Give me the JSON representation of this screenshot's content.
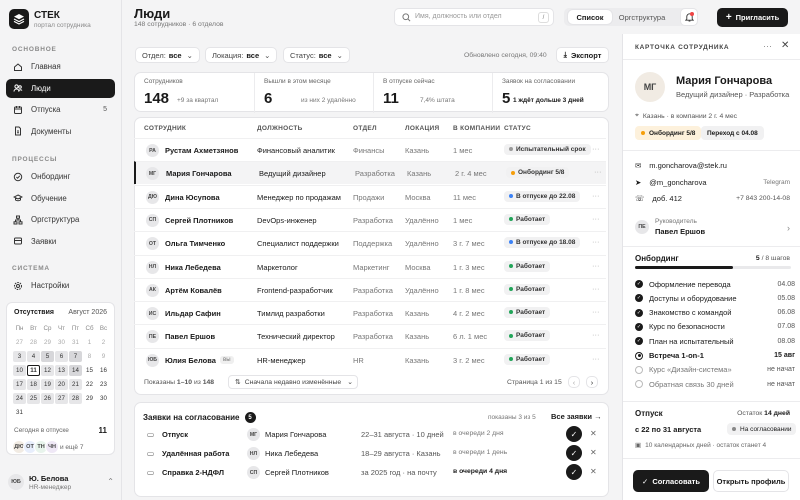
{
  "brand": {
    "name": "СТЕК",
    "sub": "портал сотрудника"
  },
  "sidebar": {
    "main_label": "ОСНОВНОЕ",
    "main_items": [
      {
        "label": "Главная",
        "icon": "home-icon"
      },
      {
        "label": "Люди",
        "icon": "people-icon",
        "active": true
      },
      {
        "label": "Отпуска",
        "icon": "calendar-icon",
        "count": "5"
      },
      {
        "label": "Документы",
        "icon": "document-icon"
      }
    ],
    "proc_label": "ПРОЦЕССЫ",
    "proc_items": [
      {
        "label": "Онбординг",
        "icon": "onboarding-icon"
      },
      {
        "label": "Обучение",
        "icon": "education-icon"
      },
      {
        "label": "Оргструктура",
        "icon": "org-icon"
      },
      {
        "label": "Заявки",
        "icon": "requests-icon"
      }
    ],
    "sys_label": "СИСТЕМА",
    "sys_items": [
      {
        "label": "Настройки",
        "icon": "gear-icon"
      }
    ]
  },
  "calendar": {
    "title": "Отсутствия",
    "month": "Август 2026",
    "weekdays": [
      "Пн",
      "Вт",
      "Ср",
      "Чт",
      "Пт",
      "Сб",
      "Вс"
    ],
    "days": [
      {
        "d": "27",
        "m": 1
      },
      {
        "d": "28",
        "m": 1
      },
      {
        "d": "29",
        "m": 1
      },
      {
        "d": "30",
        "m": 1
      },
      {
        "d": "31",
        "m": 1
      },
      {
        "d": "1",
        "m": 1
      },
      {
        "d": "2",
        "m": 1
      },
      {
        "d": "3",
        "e": 1
      },
      {
        "d": "4",
        "e": 1
      },
      {
        "d": "5",
        "e": 2
      },
      {
        "d": "6",
        "e": 1
      },
      {
        "d": "7",
        "e": 2
      },
      {
        "d": "8",
        "m": 1
      },
      {
        "d": "9",
        "m": 1
      },
      {
        "d": "10",
        "e": 1
      },
      {
        "d": "11",
        "t": 1
      },
      {
        "d": "12",
        "e": 1
      },
      {
        "d": "13",
        "e": 1
      },
      {
        "d": "14",
        "e": 2
      },
      {
        "d": "15"
      },
      {
        "d": "16"
      },
      {
        "d": "17",
        "e": 1
      },
      {
        "d": "18",
        "e": 1
      },
      {
        "d": "19",
        "e": 1
      },
      {
        "d": "20",
        "e": 1
      },
      {
        "d": "21",
        "e": 1
      },
      {
        "d": "22"
      },
      {
        "d": "23"
      },
      {
        "d": "24",
        "e": 1
      },
      {
        "d": "25",
        "e": 1
      },
      {
        "d": "26",
        "e": 1
      },
      {
        "d": "27",
        "e": 1
      },
      {
        "d": "28",
        "e": 1
      },
      {
        "d": "29"
      },
      {
        "d": "30"
      },
      {
        "d": "31"
      }
    ],
    "today_label": "Сегодня в отпуске",
    "today_count": "11",
    "avatars": [
      "ДЮ",
      "ОТ",
      "ТН",
      "ЧН"
    ],
    "more": "и ещё 7"
  },
  "current_user": {
    "initials": "ЮБ",
    "name": "Ю. Белова",
    "role": "HR-менеджер"
  },
  "header": {
    "title": "Люди",
    "subtitle": "148 сотрудников · 6 отделов",
    "search_placeholder": "Имя, должность или отдел",
    "search_key": "/",
    "view_list": "Список",
    "view_org": "Оргструктура",
    "invite": "Пригласить"
  },
  "filters": {
    "dept_label": "Отдел:",
    "dept_value": "все",
    "loc_label": "Локация:",
    "loc_value": "все",
    "status_label": "Статус:",
    "status_value": "все",
    "updated": "Обновлено сегодня, 09:40",
    "export": "Экспорт"
  },
  "kpis": [
    {
      "label": "Сотрудников",
      "value": "148",
      "sub": "+9 за квартал"
    },
    {
      "label": "Вышли в этом месяце",
      "value": "6",
      "sub": "из них 2 удалённо"
    },
    {
      "label": "В отпуске сейчас",
      "value": "11",
      "sub": "7,4% штата"
    },
    {
      "label": "Заявок на согласовании",
      "value": "5",
      "sub": "1 ждёт дольше 3 дней"
    }
  ],
  "table": {
    "columns": [
      "СОТРУДНИК",
      "ДОЛЖНОСТЬ",
      "ОТДЕЛ",
      "ЛОКАЦИЯ",
      "В КОМПАНИИ",
      "СТАТУС"
    ],
    "rows": [
      {
        "initials": "РА",
        "name": "Рустам Ахметзянов",
        "role": "Финансовый аналитик",
        "dept": "Финансы",
        "loc": "Казань",
        "tenure": "1 мес",
        "status": "Испытательный срок",
        "color": "#9a9a9a"
      },
      {
        "initials": "МГ",
        "name": "Мария Гончарова",
        "role": "Ведущий дизайнер",
        "dept": "Разработка",
        "loc": "Казань",
        "tenure": "2 г. 4 мес",
        "status": "Онбординг 5/8",
        "color": "#f59e0b",
        "sel": true
      },
      {
        "initials": "ДЮ",
        "name": "Дина Юсупова",
        "role": "Менеджер по продажам",
        "dept": "Продажи",
        "loc": "Москва",
        "tenure": "11 мес",
        "status": "В отпуске до 22.08",
        "color": "#3b82f6"
      },
      {
        "initials": "СП",
        "name": "Сергей Плотников",
        "role": "DevOps-инженер",
        "dept": "Разработка",
        "loc": "Удалённо",
        "tenure": "1 мес",
        "status": "Работает",
        "color": "#22a559"
      },
      {
        "initials": "ОТ",
        "name": "Ольга Тимченко",
        "role": "Специалист поддержки",
        "dept": "Поддержка",
        "loc": "Удалённо",
        "tenure": "3 г. 7 мес",
        "status": "В отпуске до 18.08",
        "color": "#3b82f6"
      },
      {
        "initials": "НЛ",
        "name": "Ника Лебедева",
        "role": "Маркетолог",
        "dept": "Маркетинг",
        "loc": "Москва",
        "tenure": "1 г. 3 мес",
        "status": "Работает",
        "color": "#22a559"
      },
      {
        "initials": "АК",
        "name": "Артём Ковалёв",
        "role": "Frontend-разработчик",
        "dept": "Разработка",
        "loc": "Удалённо",
        "tenure": "1 г. 8 мес",
        "status": "Работает",
        "color": "#22a559"
      },
      {
        "initials": "ИС",
        "name": "Ильдар Сафин",
        "role": "Тимлид разработки",
        "dept": "Разработка",
        "loc": "Казань",
        "tenure": "4 г. 2 мес",
        "status": "Работает",
        "color": "#22a559"
      },
      {
        "initials": "ПЕ",
        "name": "Павел Ершов",
        "role": "Технический директор",
        "dept": "Разработка",
        "loc": "Казань",
        "tenure": "6 л. 1 мес",
        "status": "Работает",
        "color": "#22a559"
      },
      {
        "initials": "ЮБ",
        "name": "Юлия Белова",
        "you": "вы",
        "role": "HR-менеджер",
        "dept": "HR",
        "loc": "Казань",
        "tenure": "3 г. 2 мес",
        "status": "Работает",
        "color": "#22a559"
      }
    ],
    "shown_prefix": "Показаны",
    "shown_range": "1–10",
    "shown_mid": "из",
    "shown_total": "148",
    "sort": "Сначала недавно изменённые",
    "page": "Страница 1 из 15"
  },
  "requests": {
    "title": "Заявки на согласование",
    "count": "5",
    "shown": "показаны 3 из 5",
    "all": "Все заявки",
    "items": [
      {
        "type": "Отпуск",
        "icon": "vacation-icon",
        "initials": "МГ",
        "person": "Мария Гончарова",
        "detail": "22–31 августа · 10 дней",
        "queue": "в очереди 2 дня",
        "urgent": false
      },
      {
        "type": "Удалённая работа",
        "icon": "remote-icon",
        "initials": "НЛ",
        "person": "Ника Лебедева",
        "detail": "18–29 августа · Казань",
        "queue": "в очереди 1 день",
        "urgent": false
      },
      {
        "type": "Справка 2-НДФЛ",
        "icon": "certificate-icon",
        "initials": "СП",
        "person": "Сергей Плотников",
        "detail": "за 2025 год · на почту",
        "queue": "в очереди 4 дня",
        "urgent": true
      }
    ]
  },
  "profile": {
    "panel_title": "КАРТОЧКА СОТРУДНИКА",
    "initials": "МГ",
    "name": "Мария Гончарова",
    "role": "Ведущий дизайнер · Разработка",
    "location": "Казань · в компании 2 г. 4 мес",
    "badge1": "Онбординг 5/8",
    "badge2": "Переход с 04.08",
    "email": "m.goncharova@stek.ru",
    "tg": "@m_goncharova",
    "tg_label": "Telegram",
    "ext": "доб. 412",
    "phone": "+7 843 200-14-08",
    "mgr_label": "Руководитель",
    "mgr_initials": "ПЕ",
    "mgr_name": "Павел Ершов",
    "onb_title": "Онбординг",
    "onb_done": "5",
    "onb_total": "/ 8 шагов",
    "onb_progress": 0.625,
    "checklist": [
      {
        "label": "Оформление перевода",
        "date": "04.08",
        "state": "done"
      },
      {
        "label": "Доступы и оборудование",
        "date": "05.08",
        "state": "done"
      },
      {
        "label": "Знакомство с командой",
        "date": "06.08",
        "state": "done"
      },
      {
        "label": "Курс по безопасности",
        "date": "07.08",
        "state": "done"
      },
      {
        "label": "План на испытательный",
        "date": "08.08",
        "state": "done"
      },
      {
        "label": "Встреча 1-on-1",
        "date": "15 авг",
        "state": "current"
      },
      {
        "label": "Курс «Дизайн-система»",
        "date": "не начат",
        "state": "todo"
      },
      {
        "label": "Обратная связь 30 дней",
        "date": "не начат",
        "state": "todo"
      }
    ],
    "vac_title": "Отпуск",
    "vac_left_label": "Остаток",
    "vac_left": "14 дней",
    "vac_dates": "с 22 по 31 августа",
    "vac_status": "На согласовании",
    "vac_note": "10 календарных дней · остаток станет 4",
    "approve": "Согласовать",
    "open": "Открыть профиль"
  }
}
